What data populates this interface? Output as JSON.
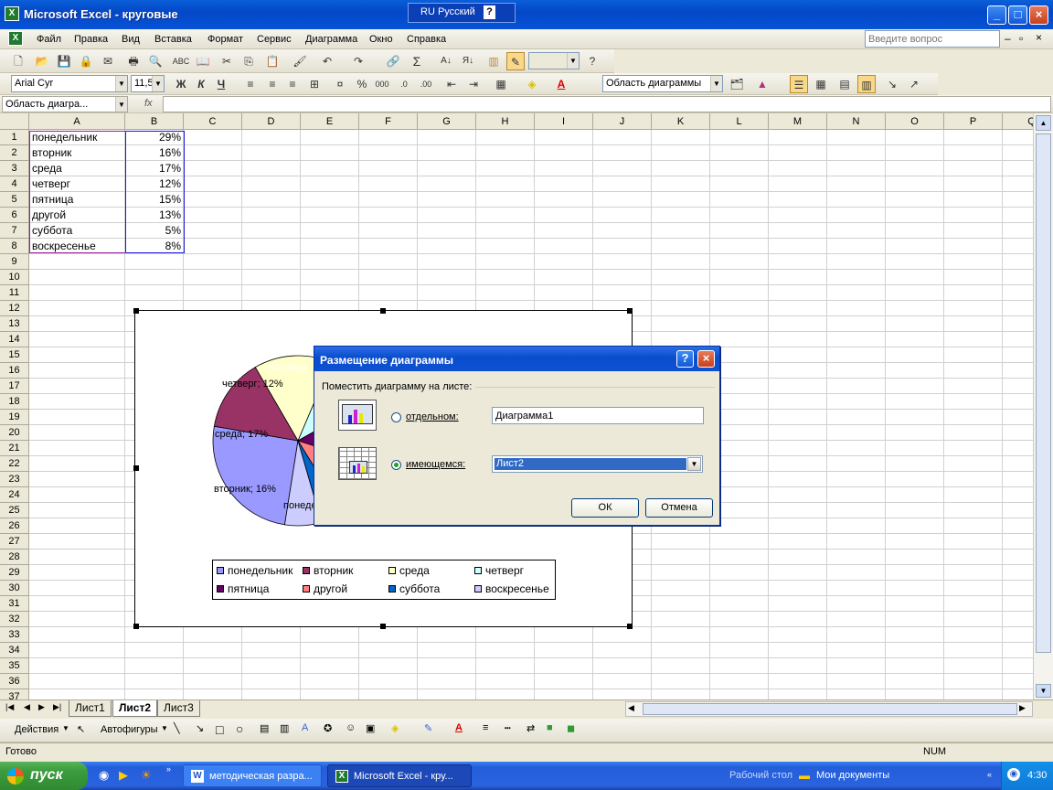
{
  "window": {
    "title": "Microsoft Excel - круговые",
    "lang": "RU Русский",
    "help_question": "Введите вопрос"
  },
  "menu": [
    "Файл",
    "Правка",
    "Вид",
    "Вставка",
    "Формат",
    "Сервис",
    "Диаграмма",
    "Окно",
    "Справка"
  ],
  "format_bar": {
    "font": "Arial Cyr",
    "size": "11,5",
    "bold": "Ж",
    "italic": "К",
    "underline": "Ч",
    "percent": "%",
    "thousands": "000",
    "chart_object": "Область диаграммы"
  },
  "formula_bar": {
    "name_box": "Область диагра...",
    "fx": "fx"
  },
  "columns": [
    "A",
    "B",
    "C",
    "D",
    "E",
    "F",
    "G",
    "H",
    "I",
    "J",
    "K",
    "L",
    "M",
    "N",
    "O",
    "P",
    "Q"
  ],
  "rows": [
    "1",
    "2",
    "3",
    "4",
    "5",
    "6",
    "7",
    "8",
    "9",
    "10",
    "11",
    "12",
    "13",
    "14",
    "15",
    "16",
    "17",
    "18",
    "19",
    "20",
    "21",
    "22",
    "23",
    "24",
    "25",
    "26",
    "27",
    "28",
    "29",
    "30",
    "31",
    "32",
    "33",
    "34",
    "35",
    "36",
    "37"
  ],
  "cells": [
    {
      "a": "понедельник",
      "b": "29%"
    },
    {
      "a": "вторник",
      "b": "16%"
    },
    {
      "a": "среда",
      "b": "17%"
    },
    {
      "a": "четверг",
      "b": "12%"
    },
    {
      "a": "пятница",
      "b": "15%"
    },
    {
      "a": "другой",
      "b": "13%"
    },
    {
      "a": "суббота",
      "b": "5%"
    },
    {
      "a": "воскресенье",
      "b": "8%"
    }
  ],
  "chart_data": {
    "type": "pie",
    "categories": [
      "понедельник",
      "вторник",
      "среда",
      "четверг",
      "пятница",
      "другой",
      "суббота",
      "воскресенье"
    ],
    "values": [
      29,
      16,
      17,
      12,
      15,
      13,
      5,
      8
    ],
    "colors": [
      "#9999ff",
      "#993366",
      "#ffffcc",
      "#ccffff",
      "#660066",
      "#ff8080",
      "#0066cc",
      "#ccccff"
    ],
    "data_labels": [
      "понеде",
      "вторник; 16%",
      "среда; 17%",
      "четверг; 12%",
      "пятница",
      "",
      "",
      ""
    ],
    "legend": "bottom"
  },
  "dialog": {
    "title": "Размещение диаграммы",
    "group_label": "Поместить диаграмму на листе:",
    "option_separate": "отдельном:",
    "option_existing": "имеющемся:",
    "separate_value": "Диаграмма1",
    "existing_value": "Лист2",
    "ok": "ОК",
    "cancel": "Отмена"
  },
  "sheet_tabs": [
    "Лист1",
    "Лист2",
    "Лист3"
  ],
  "drawing": {
    "actions": "Действия",
    "autoshapes": "Автофигуры"
  },
  "status": {
    "left": "Готово",
    "num": "NUM"
  },
  "taskbar": {
    "start": "пуск",
    "tasks": [
      "методическая разра...",
      "Microsoft Excel - кру..."
    ],
    "desktop": "Рабочий стол",
    "docs": "Мои документы",
    "time": "4:30"
  }
}
